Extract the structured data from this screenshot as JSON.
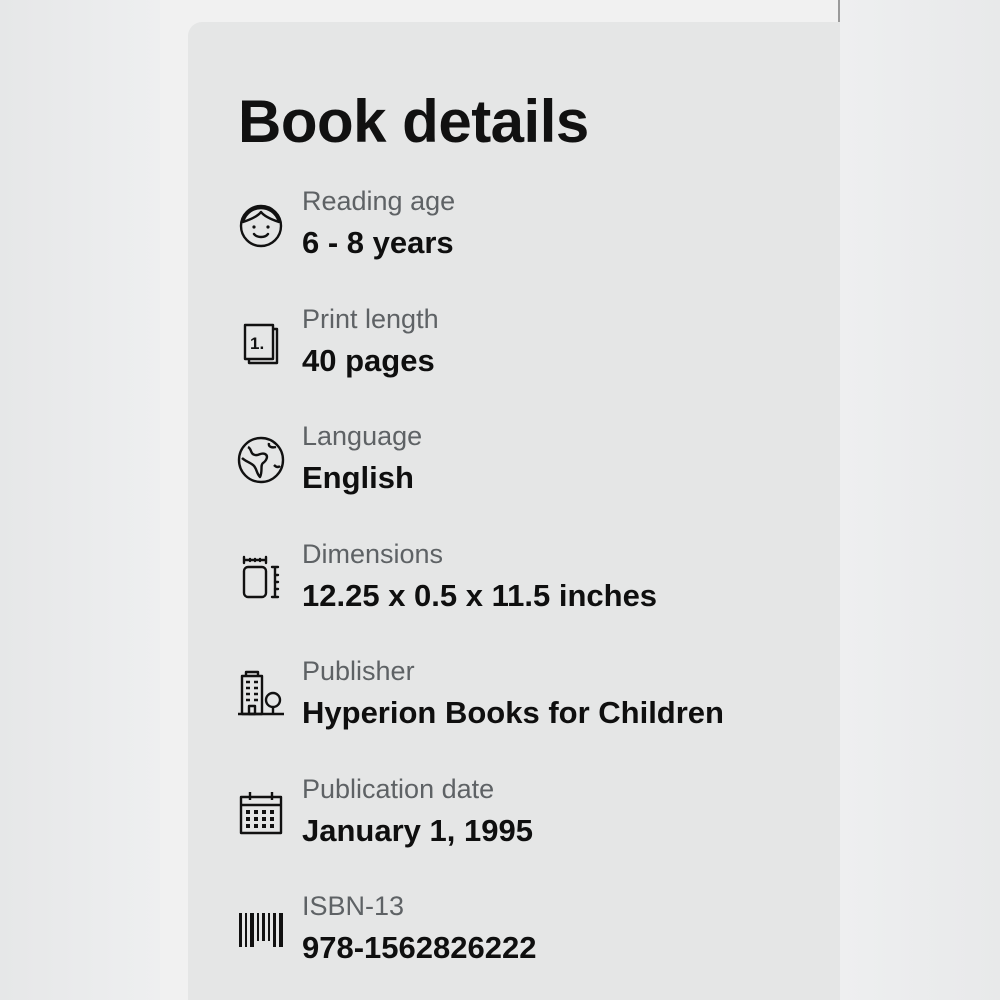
{
  "section": {
    "title": "Book details"
  },
  "details": [
    {
      "icon": "child-face-icon",
      "label": "Reading age",
      "value": "6 - 8 years"
    },
    {
      "icon": "page-number-icon",
      "label": "Print length",
      "value": "40 pages"
    },
    {
      "icon": "globe-icon",
      "label": "Language",
      "value": "English"
    },
    {
      "icon": "dimensions-icon",
      "label": "Dimensions",
      "value": "12.25 x 0.5 x 11.5 inches"
    },
    {
      "icon": "building-icon",
      "label": "Publisher",
      "value": "Hyperion Books for Children"
    },
    {
      "icon": "calendar-icon",
      "label": "Publication date",
      "value": "January 1, 1995"
    },
    {
      "icon": "barcode-icon",
      "label": "ISBN-13",
      "value": "978-1562826222"
    }
  ]
}
